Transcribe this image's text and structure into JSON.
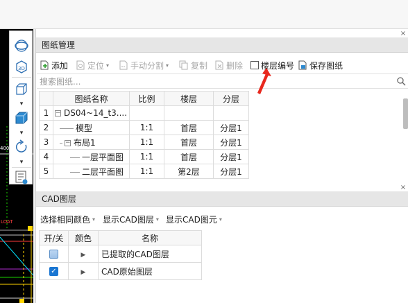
{
  "drawing_panel": {
    "title": "图纸管理",
    "toolbar": {
      "add": "添加",
      "locate": "定位",
      "manual_split": "手动分割",
      "copy": "复制",
      "delete": "删除",
      "floor_number": "楼层编号",
      "save": "保存图纸"
    },
    "search": {
      "placeholder": "搜索图纸..."
    },
    "table": {
      "headers": [
        "",
        "图纸名称",
        "比例",
        "楼层",
        "分层"
      ],
      "rows": [
        {
          "index": "1",
          "name": "DS04~14_t3....",
          "ratio": "",
          "floor": "",
          "layer": "",
          "expander": "−"
        },
        {
          "index": "2",
          "name": "模型",
          "ratio": "1:1",
          "floor": "首层",
          "layer": "分层1"
        },
        {
          "index": "3",
          "name": "布局1",
          "ratio": "1:1",
          "floor": "首层",
          "layer": "分层1",
          "expander": "−"
        },
        {
          "index": "4",
          "name": "一层平面图",
          "ratio": "1:1",
          "floor": "首层",
          "layer": "分层1"
        },
        {
          "index": "5",
          "name": "二层平面图",
          "ratio": "1:1",
          "floor": "第2层",
          "layer": "分层1"
        }
      ]
    }
  },
  "cad_panel": {
    "title": "CAD图层",
    "toolbar": {
      "select_same_color": "选择相同颜色",
      "show_cad_layer": "显示CAD图层",
      "show_cad_element": "显示CAD图元"
    },
    "table": {
      "headers": [
        "开/关",
        "颜色",
        "名称"
      ],
      "rows": [
        {
          "name": "已提取的CAD图层",
          "checked": "partial"
        },
        {
          "name": "CAD原始图层",
          "checked": "true"
        }
      ]
    }
  },
  "canvas_labels": {
    "coord": "400",
    "tag": "LOAT"
  },
  "colors": {
    "accent": "#1a76d2",
    "arrow": "#e8281e",
    "canvas": "#000000"
  }
}
